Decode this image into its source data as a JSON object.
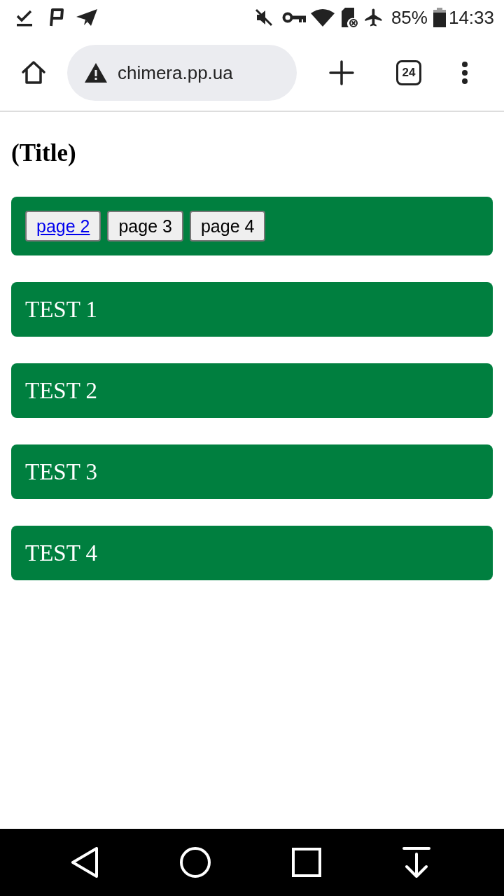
{
  "status_bar": {
    "battery_percent": "85%",
    "time": "14:33"
  },
  "browser_toolbar": {
    "url": "chimera.pp.ua",
    "tab_count": "24"
  },
  "page": {
    "title": "(Title)",
    "nav_buttons": [
      {
        "label": "page 2",
        "kind": "link"
      },
      {
        "label": "page 3",
        "kind": "plain"
      },
      {
        "label": "page 4",
        "kind": "plain"
      }
    ],
    "sections": [
      "TEST 1",
      "TEST 2",
      "TEST 3",
      "TEST 4"
    ]
  }
}
